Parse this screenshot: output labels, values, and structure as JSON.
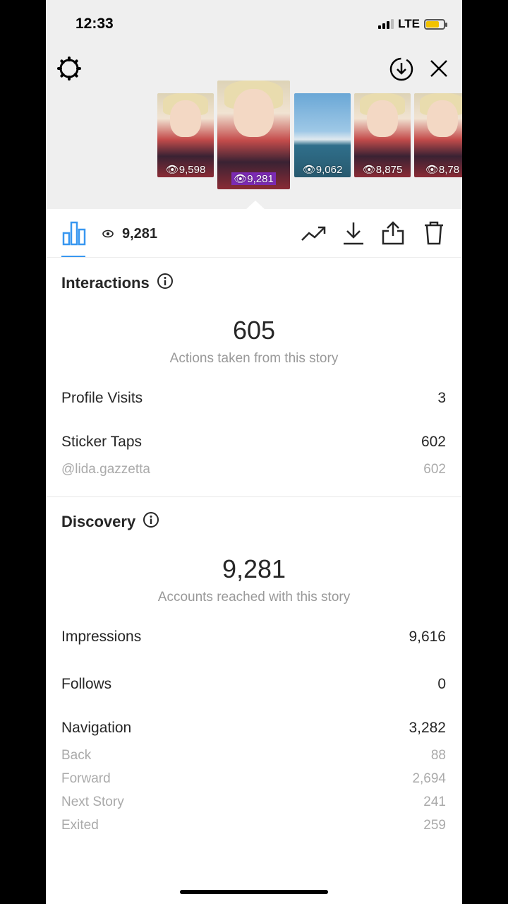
{
  "status": {
    "time": "12:33",
    "network": "LTE"
  },
  "thumbnails": [
    {
      "views": "9,598",
      "kind": "face"
    },
    {
      "views": "9,281",
      "kind": "face",
      "selected": true
    },
    {
      "views": "9,062",
      "kind": "sea"
    },
    {
      "views": "8,875",
      "kind": "face"
    },
    {
      "views": "8,78",
      "kind": "face"
    }
  ],
  "toolbar": {
    "views": "9,281"
  },
  "interactions": {
    "title": "Interactions",
    "total": "605",
    "total_label": "Actions taken from this story",
    "rows": [
      {
        "label": "Profile Visits",
        "value": "3"
      },
      {
        "label": "Sticker Taps",
        "value": "602"
      }
    ],
    "sticker_sub": {
      "label": "@lida.gazzetta",
      "value": "602"
    }
  },
  "discovery": {
    "title": "Discovery",
    "total": "9,281",
    "total_label": "Accounts reached with this story",
    "impressions": {
      "label": "Impressions",
      "value": "9,616"
    },
    "follows": {
      "label": "Follows",
      "value": "0"
    },
    "navigation": {
      "label": "Navigation",
      "value": "3,282"
    },
    "nav_rows": [
      {
        "label": "Back",
        "value": "88"
      },
      {
        "label": "Forward",
        "value": "2,694"
      },
      {
        "label": "Next Story",
        "value": "241"
      },
      {
        "label": "Exited",
        "value": "259"
      }
    ]
  },
  "colors": {
    "accent": "#3897f0",
    "sticker": "#7c2bb3",
    "battery": "#f2c200"
  },
  "icons": [
    "settings-icon",
    "save-icon",
    "close-icon",
    "insights-icon",
    "eye-icon",
    "promote-icon",
    "download-icon",
    "share-icon",
    "delete-icon",
    "info-icon"
  ]
}
